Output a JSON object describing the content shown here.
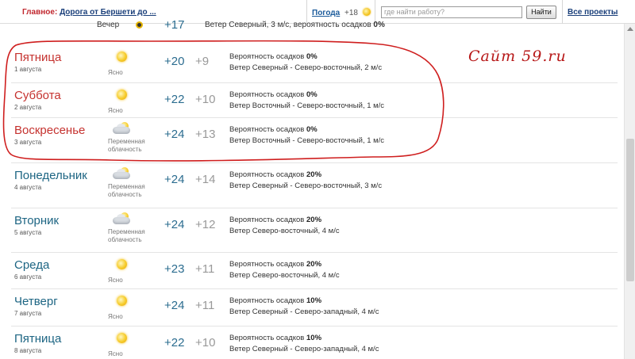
{
  "topbar": {
    "main_label": "Главное:",
    "main_link": "Дорога от Бершети до ...",
    "weather_link": "Погода",
    "weather_temp": "+18",
    "search_placeholder": "где найти работу?",
    "search_button": "Найти",
    "all_projects": "Все проекты"
  },
  "evening": {
    "label": "Вечер",
    "temp": "+17",
    "text": "Ветер Северный, 3 м/с, вероятность осадков",
    "precip": "0%"
  },
  "forecast": [
    {
      "day": "Пятница",
      "date": "1 августа",
      "icon": "sun-icon",
      "cond": "Ясно",
      "t_day": "+20",
      "t_night": "+9",
      "precip_label": "Вероятность осадков",
      "precip": "0%",
      "wind": "Ветер Северный - Северо-восточный, 2 м/с",
      "highlight": true
    },
    {
      "day": "Суббота",
      "date": "2 августа",
      "icon": "sun-icon",
      "cond": "Ясно",
      "t_day": "+22",
      "t_night": "+10",
      "precip_label": "Вероятность осадков",
      "precip": "0%",
      "wind": "Ветер Восточный - Северо-восточный, 1 м/с",
      "highlight": true
    },
    {
      "day": "Воскресенье",
      "date": "3 августа",
      "icon": "partly-cloudy-icon",
      "cond": "Переменная облачность",
      "t_day": "+24",
      "t_night": "+13",
      "precip_label": "Вероятность осадков",
      "precip": "0%",
      "wind": "Ветер Восточный - Северо-восточный, 1 м/с",
      "highlight": true
    },
    {
      "day": "Понедельник",
      "date": "4 августа",
      "icon": "partly-cloudy-icon",
      "cond": "Переменная облачность",
      "t_day": "+24",
      "t_night": "+14",
      "precip_label": "Вероятность осадков",
      "precip": "20%",
      "wind": "Ветер Северный - Северо-восточный, 3 м/с",
      "highlight": false
    },
    {
      "day": "Вторник",
      "date": "5 августа",
      "icon": "partly-cloudy-icon",
      "cond": "Переменная облачность",
      "t_day": "+24",
      "t_night": "+12",
      "precip_label": "Вероятность осадков",
      "precip": "20%",
      "wind": "Ветер Северо-восточный, 4 м/с",
      "highlight": false
    },
    {
      "day": "Среда",
      "date": "6 августа",
      "icon": "sun-icon",
      "cond": "Ясно",
      "t_day": "+23",
      "t_night": "+11",
      "precip_label": "Вероятность осадков",
      "precip": "20%",
      "wind": "Ветер Северо-восточный, 4 м/с",
      "highlight": false
    },
    {
      "day": "Четверг",
      "date": "7 августа",
      "icon": "sun-icon",
      "cond": "Ясно",
      "t_day": "+24",
      "t_night": "+11",
      "precip_label": "Вероятность осадков",
      "precip": "10%",
      "wind": "Ветер Северный - Северо-западный, 4 м/с",
      "highlight": false
    },
    {
      "day": "Пятница",
      "date": "8 августа",
      "icon": "sun-icon",
      "cond": "Ясно",
      "t_day": "+22",
      "t_night": "+10",
      "precip_label": "Вероятность осадков",
      "precip": "10%",
      "wind": "Ветер Северный - Северо-западный, 4 м/с",
      "highlight": false
    }
  ],
  "annotation": "Сайт 59.ru",
  "colors": {
    "day_name": "#1d6583",
    "highlight_day_name": "#c5322f",
    "temp_day": "#2b6c8f",
    "temp_night": "#999999",
    "annotation_ink": "#b71818"
  }
}
